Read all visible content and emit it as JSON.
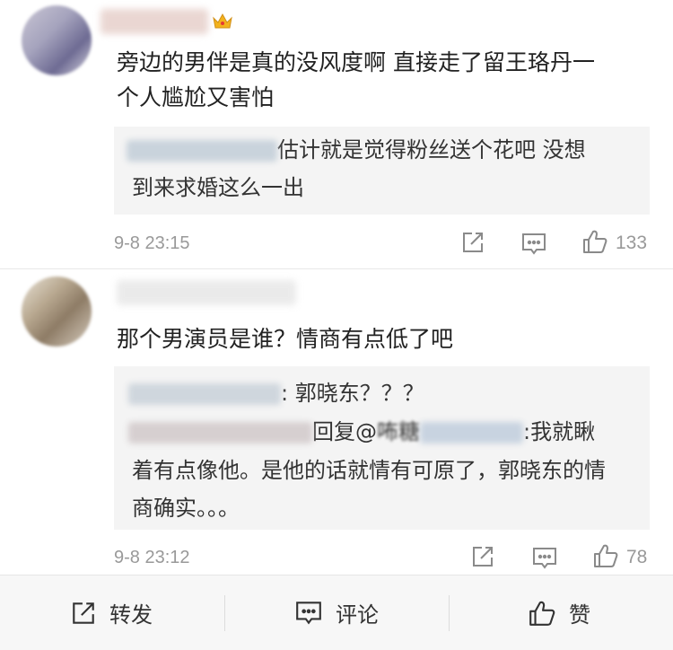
{
  "comments": [
    {
      "text_lines": [
        "旁边的男伴是真的没风度啊 直接走了留王珞丹一",
        "个人尴尬又害怕"
      ],
      "reply": {
        "lines": [
          {
            "after_name": "估计就是觉得粉丝送个花吧  没想"
          },
          {
            "text": "到来求婚这么一出"
          }
        ]
      },
      "time": "9-8 23:15",
      "likes": "133"
    },
    {
      "text_lines": [
        "那个男演员是谁？情商有点低了吧"
      ],
      "reply": {
        "line1_after": ": 郭晓东？？？",
        "line2_mid": "回复@",
        "line2_name_part": "咘糖",
        "line2_after": ":我就瞅",
        "line3": "着有点像他。是他的话就情有可原了，郭晓东的情",
        "line4": "商确实。。。"
      },
      "time": "9-8 23:12",
      "likes": "78"
    }
  ],
  "bottom_bar": {
    "repost_label": "转发",
    "comment_label": "评论",
    "like_label": "赞"
  },
  "icons": {
    "crown": "crown-icon",
    "share": "share-icon",
    "comment": "comment-icon",
    "like": "thumbs-up-icon"
  },
  "colors": {
    "meta_gray": "#999999",
    "crown_gold": "#f3b21c",
    "reply_bg": "#f4f4f4"
  }
}
